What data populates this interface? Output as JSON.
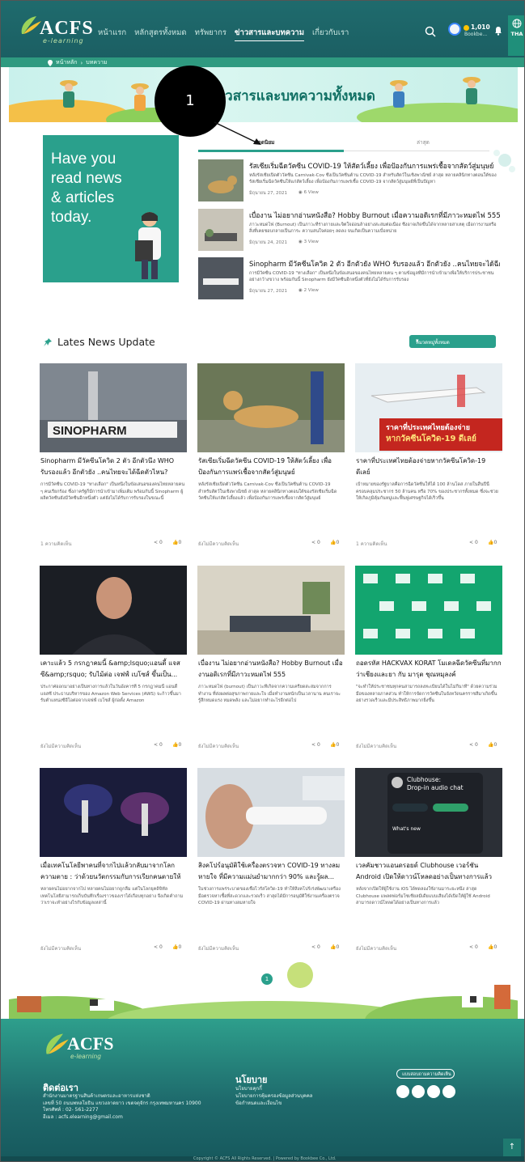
{
  "header": {
    "logo_text": "ACFS",
    "logo_sub": "e-learning",
    "nav": [
      {
        "label": "หน้าแรก",
        "active": false
      },
      {
        "label": "หลักสูตรทั้งหมด",
        "active": false
      },
      {
        "label": "ทรัพยากร",
        "active": false
      },
      {
        "label": "ข่าวสารและบทความ",
        "active": true
      },
      {
        "label": "เกี่ยวกับเรา",
        "active": false
      }
    ],
    "coins": "1,010",
    "coins_sub": "Bookbe...",
    "lang": "THA"
  },
  "breadcrumb": {
    "home": "หน้าหลัก",
    "current": "บทความ"
  },
  "banner": {
    "title": "ข่าวสารและบทความทั้งหมด"
  },
  "callout": {
    "number": "1"
  },
  "featured": {
    "promo_text": [
      "Have you",
      "read news",
      "& articles",
      "today."
    ],
    "tabs": {
      "popular": "ยอดนิยม",
      "latest": "ล่าสุด"
    },
    "items": [
      {
        "title": "รัสเซียเริ่มฉีดวัคซีน COVID-19 ให้สัตว์เลี้ยง เพื่อป้องกันการแพร่เชื้อจากสัตว์สู่มนุษย์",
        "desc": "หลังรัสเซียเปิดตัววัคซีน Carnivak-Cov ซึ่งเป็นวัคซีนต้าน COVID-19 สำหรับสัตว์ในเชิงพาณิชย์ ล่าสุด หลายคลินิกทางตอนใต้ของรัสเซียเริ่มฉีดวัคซีนให้แก่สัตว์เลี้ยง เพื่อป้องกันการแพร่เชื้อ COVID-19 จากสัตว์สู่มนุษย์ที่เป็นปัญหา",
        "date": "มิถุนายน 27, 2021",
        "views": "6 View"
      },
      {
        "title": "เบื่องาน ไม่อยากอ่านหนังสือ? Hobby Burnout เมื่อความอดิเรกที่มีภาวะหมดไฟ 555",
        "desc": "ภาวะหมดไฟ (Burnout) เป็นภาวะที่ร่างกายและจิตใจอ่อนล้าอย่างสะสมต่อเนื่อง ซึ่งอาจเกิดขึ้นได้จากหลายสาเหตุ เมื่อการงานหรือสิ่งที่เคยชอบกลายเป็นภาระ ความสนใจค่อยๆ ลดลง จนเกิดเป็นความเบื่อหน่าย",
        "date": "มิถุนายน 24, 2021",
        "views": "3 View"
      },
      {
        "title": "Sinopharm มีวัคซีนโควิด 2 ตัว อีกตัวยัง WHO รับรองแล้ว อีกตัวยัง ..คนไทยจะได้ฉีดตัวไหน?",
        "desc": "การมีวัคซีน COVID-19 \"ทางเลือก\" เป็นหนึ่งในข้อเสนอของคนไทยหลายคน ๆ ตามข้อมูลที่มีการนำเข้ามาเพื่อให้บริการประชาชนอย่างกว้างขวาง พร้อมกันนี้ Sinopharm ยังมีวัคซีนอีกหนึ่งตัวที่ยังไม่ได้รับการรับรอง",
        "date": "มิถุนายน 27, 2021",
        "views": "2 View"
      }
    ]
  },
  "latest": {
    "heading": "Lates News Update",
    "filter": "หมวดหมู่ทั้งหมด",
    "cards": [
      {
        "title": "Sinopharm มีวัคซีนโควิด 2 ตัว อีกตัวนึง WHO รับรองแล้ว อีกตัวยัง ..คนไทยจะได้ฉีดตัวไหน?",
        "desc": "การมีวัคซีน COVID-19 \"ทางเลือก\" เป็นหนึ่งในข้อเสนอของคนไทยหลายคน ๆ คนเรียกร้อง ซึ่งภาครัฐก็มีการนำเข้ามาเพิ่มเติม พร้อมกันนี้ Sinopharm ผู้ผลิตวัคซีนยังมีวัคซีนอีกหนึ่งตัว แต่ยังไม่ได้รับการรับรองในขณะนี้",
        "comments": "1 ความคิดเห็น",
        "shares": "0",
        "likes": "0",
        "img": "sinopharm"
      },
      {
        "title": "รัสเซียเริ่มฉีดวัคซีน COVID-19 ให้สัตว์เลี้ยง เพื่อป้องกันการแพร่เชื้อจากสัตว์สู่มนุษย์",
        "desc": "หลังรัสเซียเปิดตัววัคซีน Carnivak-Cov ซึ่งเป็นวัคซีนต้าน COVID-19 สำหรับสัตว์ในเชิงพาณิชย์ ล่าสุด หลายคลินิกทางตอนใต้ของรัสเซียเริ่มฉีดวัคซีนให้แก่สัตว์เลี้ยงแล้ว เพื่อป้องกันการแพร่เชื้อจากสัตว์สู่มนุษย์",
        "comments": "ยังไม่มีความคิดเห็น",
        "shares": "0",
        "likes": "0",
        "img": "dog"
      },
      {
        "title": "ราคาที่ประเทศไทยต้องจ่ายหากวัคซีนโควิด-19 ดีเลย์",
        "desc": "เป้าหมายของรัฐบาลคือการฉีดวัคซีนให้ได้ 100 ล้านโดส ภายในสิ้นปีนี้ ครอบคลุมประชากร 50 ล้านคน หรือ 70% ของประชากรทั้งหมด ซึ่งจะช่วยให้เกิดภูมิคุ้มกันหมู่และฟื้นฟูเศรษฐกิจได้เร็วขึ้น",
        "comments": "1 ความคิดเห็น",
        "shares": "0",
        "likes": "0",
        "img": "plane",
        "overlay1": "ราคาที่ประเทศไทยต้องจ่าย",
        "overlay2": "หากวัคซีนโควิด-19 ดีเลย์"
      },
      {
        "title": "เคาะแล้ว 5 กรกฎาคมนี้ &amp;lsquo;แอนดี้ แจสซี&amp;rsquo; รับไม้ต่อ เจฟฟ์ เบโซส์ ขึ้นเป็น...",
        "desc": "ประกาศออกมาอย่างเป็นทางการแล้วในวันอังคารที่ 5 กรกฎาคมนี้ แอนดี้ แจสซี ประธานบริหารของ Amazon Web Services (AWS) จะก้าวขึ้นมารับตำแหน่งซีอีโอต่อจากเจฟฟ์ เบโซส์ ผู้ก่อตั้ง Amazon",
        "comments": "ยังไม่มีความคิดเห็น",
        "shares": "0",
        "likes": "0",
        "img": "bezos"
      },
      {
        "title": "เบื่องาน ไม่อยากอ่านหนังสือ? Hobby Burnout เมื่องานอดิเรกที่มีภาวะหมดไฟ 555",
        "desc": "ภาวะหมดไฟ (burnout) เป็นภาวะที่เกิดจากความเครียดสะสมจากการทำงาน ที่ส่งผลต่อสุขภาพกายและใจ เมื่อทำงานหนักเป็นเวลานาน คนเราจะรู้สึกหมดแรง หมดพลัง และไม่อยากทำอะไรอีกต่อไป",
        "comments": "ยังไม่มีความคิดเห็น",
        "shares": "0",
        "likes": "0",
        "img": "burnout"
      },
      {
        "title": "ถอดรหัส HACKVAX KORAT โมเดลฉีดวัคซีนที่มากกว่าเชียงและยา กับ มารุต ชุณหมุลงค์",
        "desc": "\"จะทำให้ประชาชนทุกคนสามารถลงทะเบียนได้ในไม่กี่นาที\" ด้วยความร่วมมือของหลายภาคส่วน ทำให้การจัดการวัคซีนในจังหวัดนครราชสีมาเกิดขึ้นอย่างรวดเร็วและมีประสิทธิภาพมากยิ่งขึ้น",
        "comments": "ยังไม่มีความคิดเห็น",
        "shares": "0",
        "likes": "0",
        "img": "hackvax"
      },
      {
        "title": "เมื่อเทคโนโลยีพาคนที่จากไปแล้วกลับมาจากโลกความตาย : ว่าด้วยนวัตกรรมกับการเรียกคนตายให้กลับมา",
        "desc": "หลายคนไม่อยากจากไป หลายคนไม่อยากถูกลืม แต่ในโลกยุคดิจิทัล เทคโนโลยีสามารถเก็บบันทึกเรื่องราวของเราได้เกือบทุกอย่าง จึงเกิดคำถามว่าเราจะทำอย่างไรกับข้อมูลเหล่านี้",
        "comments": "ยังไม่มีความคิดเห็น",
        "shares": "0",
        "likes": "0",
        "img": "dance"
      },
      {
        "title": "สิงคโปร์อนุมัติใช้เครื่องตรวจหา COVID-19 ทางลมหายใจ ที่มีความแม่นยำมากกว่า 90% และรู้ผล...",
        "desc": "ในช่วงการแพร่ระบาดของเชื้อไวรัสโควิด-19 ทำให้สิงคโปร์เร่งพัฒนาเครื่องมือตรวจหาเชื้อที่สะดวกและรวดเร็ว ล่าสุดได้มีการอนุมัติใช้งานเครื่องตรวจ COVID-19 ผ่านทางลมหายใจ",
        "comments": "ยังไม่มีความคิดเห็น",
        "shares": "0",
        "likes": "0",
        "img": "breath"
      },
      {
        "title": "เวลคัมชาวแอนดรอยด์ Clubhouse เวอร์ชัน Android เปิดให้ดาวน์โหลดอย่างเป็นทางการแล้ว",
        "desc": "หลังจากเปิดให้ผู้ใช้งาน iOS ได้ทดลองใช้งานมาระยะหนึ่ง ล่าสุด Clubhouse แพลตฟอร์มโซเชียลมีเดียแบบเสียงได้เปิดให้ผู้ใช้ Android สามารถดาวน์โหลดได้อย่างเป็นทางการแล้ว",
        "comments": "ยังไม่มีความคิดเห็น",
        "shares": "0",
        "likes": "0",
        "img": "clubhouse",
        "ch_title": "Clubhouse:",
        "ch_sub": "Drop-in audio chat",
        "ch_new": "What's new"
      }
    ]
  },
  "pager": {
    "current": "1"
  },
  "footer": {
    "logo_text": "ACFS",
    "logo_sub": "e-learning",
    "contact_heading": "ติดต่อเรา",
    "address": [
      "สำนักงานมาตรฐานสินค้าเกษตรและอาหารแห่งชาติ",
      "เลขที่ 50 ถนนพหลโยธิน แขวงลาดยาว เขตจตุจักร กรุงเทพมหานคร 10900",
      "โทรศัพท์ : 02- 561-2277",
      "อีเมล : acfs.elearning@gmail.com"
    ],
    "policy_heading": "นโยบาย",
    "policy_links": [
      "นโยบายคุกกี้",
      "นโยบายการคุ้มครองข้อมูลส่วนบุคคล",
      "ข้อกำหนดและเงื่อนไข"
    ],
    "feedback": "แบบสอบถามความคิดเห็น",
    "copyright": "Copyright © ACFS All Rights Reserved. | Powered by Bookbee Co., Ltd."
  }
}
